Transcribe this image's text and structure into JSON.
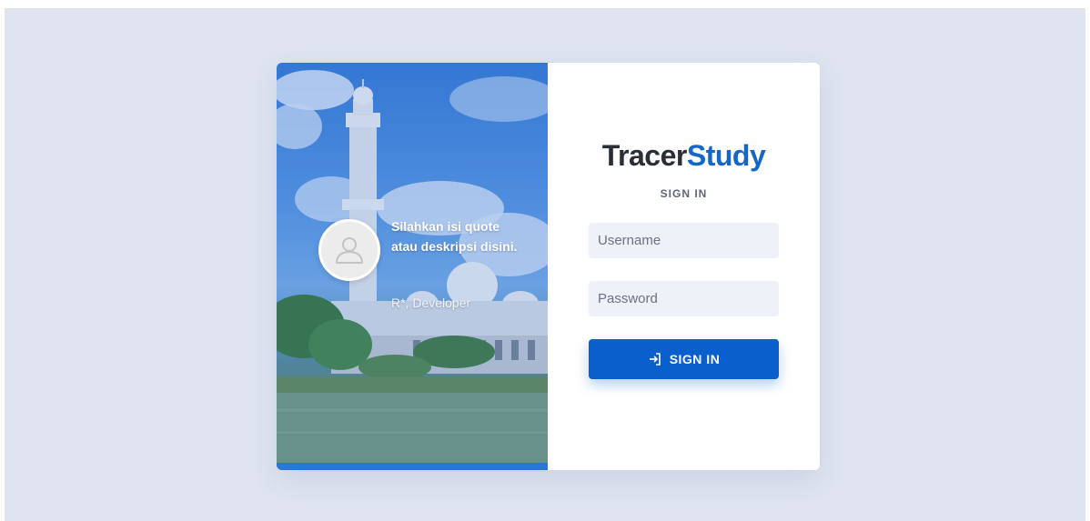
{
  "brand": {
    "part1": "Tracer",
    "part2": "Study"
  },
  "login": {
    "subtitle": "SIGN IN",
    "username_placeholder": "Username",
    "password_placeholder": "Password",
    "signin_label": "SIGN IN",
    "signin_icon": "sign-in-icon"
  },
  "testimonial": {
    "quote": "Silahkan isi quote atau deskripsi disini.",
    "author": "R*, Developer",
    "avatar_icon": "user-icon"
  },
  "colors": {
    "page_background": "#dfe4f0",
    "accent": "#1466c8",
    "button": "#0b5fcc",
    "input_background": "#eef1f8"
  }
}
